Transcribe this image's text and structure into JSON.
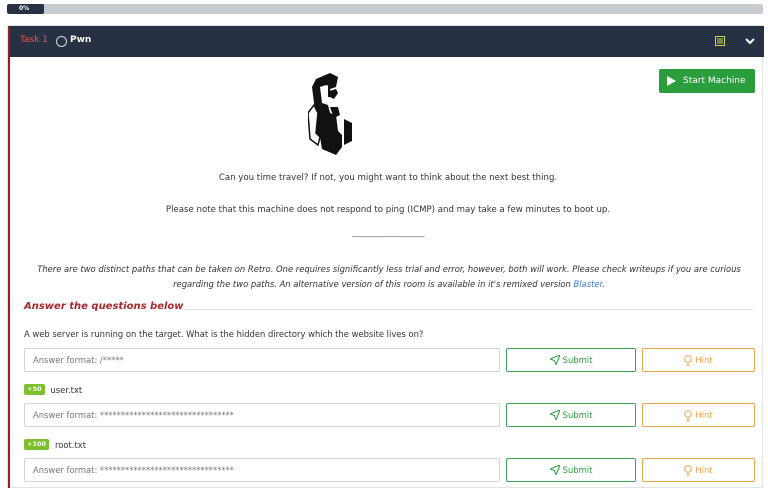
{
  "progress": {
    "label": "0%",
    "value_percent": 0
  },
  "task": {
    "number_label": "Task 1",
    "title": "Pwn"
  },
  "start_button": {
    "label": "Start Machine"
  },
  "description": {
    "line1": "Can you time travel? If not, you might want to think about the next best thing.",
    "line2": "Please note that this machine does not respond to ping (ICMP) and may take a few minutes to boot up.",
    "separator": "------------------------------------",
    "italic_text": "There are two distinct paths that can be taken on Retro. One requires significantly less trial and error, however, both will work. Please check writeups if you are curious regarding the two paths. An alternative version of this room is available in it's remixed version ",
    "link_text": "Blaster",
    "italic_end": "."
  },
  "answers": {
    "heading": "Answer the questions below",
    "questions": [
      {
        "text": "A web server is running on the target. What is the hidden directory which the website lives on?",
        "placeholder": "Answer format: /*****",
        "submit_label": "Submit",
        "hint_label": "Hint"
      },
      {
        "points": "+50",
        "text": "user.txt",
        "placeholder": "Answer format: ********************************",
        "submit_label": "Submit",
        "hint_label": "Hint"
      },
      {
        "points": "+100",
        "text": "root.txt",
        "placeholder": "Answer format: ********************************",
        "submit_label": "Submit",
        "hint_label": "Hint"
      }
    ]
  },
  "colors": {
    "header_bg": "#263244",
    "accent_red": "#a8292d",
    "green": "#2a9d3d",
    "orange": "#f0a24a",
    "points_green": "#7cbf2f"
  },
  "icons": [
    "list-icon",
    "chevron-down-icon",
    "play-icon",
    "paper-plane-icon",
    "lightbulb-icon",
    "arcade-machine-logo"
  ]
}
